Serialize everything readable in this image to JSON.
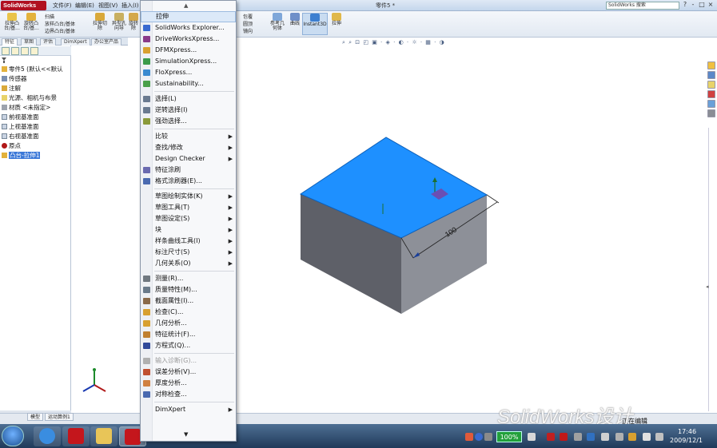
{
  "app": {
    "logo": "SolidWorks",
    "document_title": "零件5 *",
    "search_placeholder": "SolidWorks 搜索",
    "menus": [
      "文件(F)",
      "编辑(E)",
      "视图(V)",
      "插入(I)"
    ],
    "window_controls": [
      "?",
      "-",
      "□",
      "×"
    ]
  },
  "command_manager": {
    "left_buttons": [
      {
        "label": "拉伸凸\n台/基...",
        "icon": "extrude-boss-icon"
      },
      {
        "label": "旋转凸\n台/基...",
        "icon": "revolve-boss-icon"
      }
    ],
    "small_items": [
      "扫描",
      "放样凸台/基体",
      "边界凸台/基体"
    ],
    "cut_buttons": [
      {
        "label": "拉伸切\n除",
        "icon": "extrude-cut-icon"
      },
      {
        "label": "异型孔\n向导",
        "icon": "hole-wizard-icon"
      },
      {
        "label": "旋转\n除",
        "icon": "revolve-cut-icon"
      }
    ],
    "right_small_items": [
      "包覆",
      "圆顶",
      "镜向"
    ],
    "right_buttons": [
      {
        "label": "参考几\n何体",
        "icon": "reference-geometry-icon"
      },
      {
        "label": "曲线",
        "icon": "curves-icon"
      },
      {
        "label": "Instant3D",
        "icon": "instant3d-icon"
      },
      {
        "label": "拉伸",
        "icon": "extrude-icon"
      }
    ]
  },
  "tabs": [
    "特征",
    "草图",
    "评估",
    "DimXpert",
    "办公室产品"
  ],
  "feature_tree": {
    "items": [
      {
        "label": "零件5 (默认<<默认",
        "icon": "part-icon"
      },
      {
        "label": "传感器",
        "icon": "sensor-icon"
      },
      {
        "label": "注解",
        "icon": "annotation-icon"
      },
      {
        "label": "光源、相机与布景",
        "icon": "lights-icon"
      },
      {
        "label": "材质 <未指定>",
        "icon": "material-icon"
      },
      {
        "label": "前视基准面",
        "icon": "plane-icon"
      },
      {
        "label": "上视基准面",
        "icon": "plane-icon"
      },
      {
        "label": "右视基准面",
        "icon": "plane-icon"
      },
      {
        "label": "原点",
        "icon": "origin-icon"
      },
      {
        "label": "凸台-拉伸1",
        "icon": "extrude-feature-icon"
      }
    ]
  },
  "menu": {
    "items": [
      {
        "label": "拉伸",
        "icon": "",
        "highlight": true
      },
      {
        "label": "SolidWorks Explorer...",
        "icon": "explorer-icon"
      },
      {
        "label": "DriveWorksXpress...",
        "icon": "driveworks-icon"
      },
      {
        "label": "DFMXpress...",
        "icon": "dfm-icon"
      },
      {
        "label": "SimulationXpress...",
        "icon": "simulation-icon"
      },
      {
        "label": "FloXpress...",
        "icon": "flo-icon"
      },
      {
        "label": "Sustainability...",
        "icon": "sustainability-icon"
      },
      {
        "sep": true
      },
      {
        "label": "选择(L)",
        "icon": "select-icon"
      },
      {
        "label": "逆转选择(I)",
        "icon": "invert-select-icon"
      },
      {
        "label": "强劲选择...",
        "icon": "power-select-icon"
      },
      {
        "sep": true
      },
      {
        "label": "比较",
        "submenu": true
      },
      {
        "label": "查找/修改",
        "submenu": true
      },
      {
        "label": "Design Checker",
        "submenu": true
      },
      {
        "label": "特征涂刷",
        "icon": "feature-paint-icon"
      },
      {
        "label": "格式涂刷器(E)...",
        "icon": "format-painter-icon"
      },
      {
        "sep": true
      },
      {
        "label": "草图绘制实体(K)",
        "submenu": true
      },
      {
        "label": "草图工具(T)",
        "submenu": true
      },
      {
        "label": "草图设定(S)",
        "submenu": true
      },
      {
        "label": "块",
        "submenu": true
      },
      {
        "label": "样条曲线工具(I)",
        "submenu": true
      },
      {
        "label": "标注尺寸(S)",
        "submenu": true
      },
      {
        "label": "几何关系(O)",
        "submenu": true
      },
      {
        "sep": true
      },
      {
        "label": "测量(R)...",
        "icon": "measure-icon"
      },
      {
        "label": "质量特性(M)...",
        "icon": "mass-properties-icon"
      },
      {
        "label": "截面属性(I)...",
        "icon": "section-properties-icon"
      },
      {
        "label": "检查(C)...",
        "icon": "check-icon"
      },
      {
        "label": "几何分析...",
        "icon": "geometry-analysis-icon"
      },
      {
        "label": "特征统计(F)...",
        "icon": "feature-statistics-icon"
      },
      {
        "label": "方程式(Q)...",
        "icon": "equations-icon"
      },
      {
        "sep": true
      },
      {
        "label": "输入诊断(G)...",
        "icon": "import-diagnostics-icon",
        "disabled": true
      },
      {
        "label": "误差分析(V)...",
        "icon": "deviation-analysis-icon"
      },
      {
        "label": "厚度分析...",
        "icon": "thickness-analysis-icon"
      },
      {
        "label": "对称检查...",
        "icon": "symmetry-check-icon"
      },
      {
        "sep": true
      },
      {
        "label": "DimXpert",
        "submenu": true
      }
    ],
    "scroll_up": "▲",
    "scroll_down": "▼"
  },
  "model": {
    "dimension": "100",
    "top_face_color": "#1e90ff",
    "side_color": "#5a5d66",
    "front_color": "#8a8d95"
  },
  "status": {
    "tabs": [
      "模型",
      "运动算例1"
    ],
    "editing_text": "正在编辑",
    "watermark": "SolidWorks设计"
  },
  "taskbar": {
    "battery_pct": "100%",
    "time": "17:46",
    "date": "2009/12/1"
  }
}
